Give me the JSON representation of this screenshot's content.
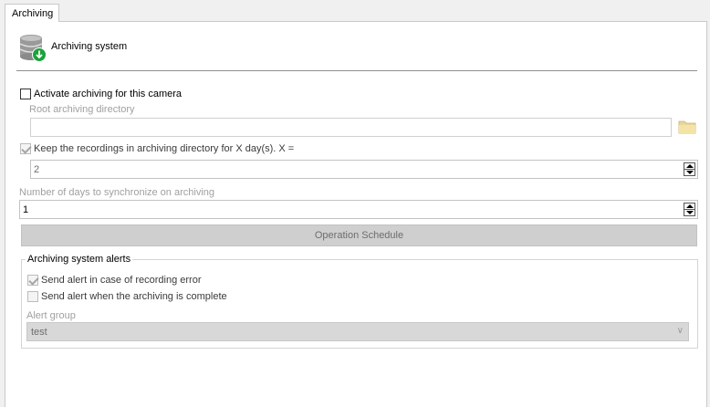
{
  "tab": {
    "label": "Archiving"
  },
  "header": {
    "title": "Archiving system",
    "icon": "database-download-icon"
  },
  "activate": {
    "label": "Activate archiving for this camera",
    "checked": false
  },
  "root_dir": {
    "label": "Root archiving directory",
    "value": "",
    "browse_icon": "folder-icon"
  },
  "keep": {
    "label": "Keep the recordings in archiving directory for X day(s). X =",
    "checked": true,
    "value": "2"
  },
  "sync": {
    "label": "Number of days to synchronize on archiving",
    "value": "1"
  },
  "schedule_button": {
    "label": "Operation Schedule"
  },
  "alerts": {
    "title": "Archiving system alerts",
    "recording_error": {
      "label": "Send alert in case of recording error",
      "checked": true
    },
    "archiving_complete": {
      "label": "Send alert when the archiving is complete",
      "checked": false
    },
    "group_label": "Alert group",
    "group_value": "test"
  },
  "colors": {
    "accent_green": "#1aa33a",
    "disabled_text": "#a0a0a0",
    "button_bg": "#cfcfcf"
  }
}
